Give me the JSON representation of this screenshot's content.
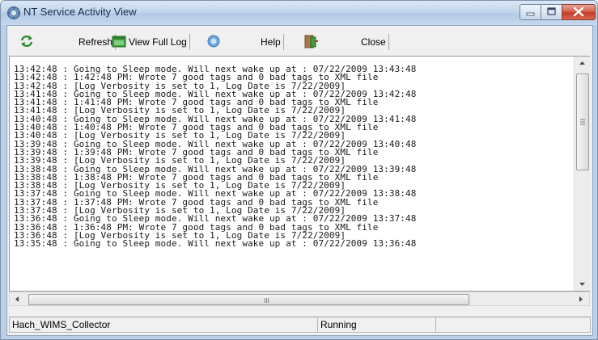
{
  "window": {
    "title": "NT Service Activity View"
  },
  "toolbar": {
    "refresh_label": "Refresh",
    "view_full_log_label": "View Full Log",
    "help_label": "Help",
    "close_label": "Close"
  },
  "log": {
    "lines": [
      "13:42:48 : Going to Sleep mode. Will next wake up at : 07/22/2009 13:43:48",
      "13:42:48 : 1:42:48 PM: Wrote 7 good tags and 0 bad tags to XML file",
      "13:42:48 : [Log Verbosity is set to 1, Log Date is 7/22/2009]",
      "13:41:48 : Going to Sleep mode. Will next wake up at : 07/22/2009 13:42:48",
      "13:41:48 : 1:41:48 PM: Wrote 7 good tags and 0 bad tags to XML file",
      "13:41:48 : [Log Verbosity is set to 1, Log Date is 7/22/2009]",
      "13:40:48 : Going to Sleep mode. Will next wake up at : 07/22/2009 13:41:48",
      "13:40:48 : 1:40:48 PM: Wrote 7 good tags and 0 bad tags to XML file",
      "13:40:48 : [Log Verbosity is set to 1, Log Date is 7/22/2009]",
      "13:39:48 : Going to Sleep mode. Will next wake up at : 07/22/2009 13:40:48",
      "13:39:48 : 1:39:48 PM: Wrote 7 good tags and 0 bad tags to XML file",
      "13:39:48 : [Log Verbosity is set to 1, Log Date is 7/22/2009]",
      "13:38:48 : Going to Sleep mode. Will next wake up at : 07/22/2009 13:39:48",
      "13:38:48 : 1:38:48 PM: Wrote 7 good tags and 0 bad tags to XML file",
      "13:38:48 : [Log Verbosity is set to 1, Log Date is 7/22/2009]",
      "13:37:48 : Going to Sleep mode. Will next wake up at : 07/22/2009 13:38:48",
      "13:37:48 : 1:37:48 PM: Wrote 7 good tags and 0 bad tags to XML file",
      "13:37:48 : [Log Verbosity is set to 1, Log Date is 7/22/2009]",
      "13:36:48 : Going to Sleep mode. Will next wake up at : 07/22/2009 13:37:48",
      "13:36:48 : 1:36:48 PM: Wrote 7 good tags and 0 bad tags to XML file",
      "13:36:48 : [Log Verbosity is set to 1, Log Date is 7/22/2009]",
      "13:35:48 : Going to Sleep mode. Will next wake up at : 07/22/2009 13:36:48"
    ]
  },
  "statusbar": {
    "service_name": "Hach_WIMS_Collector",
    "service_state": "Running"
  },
  "scroll": {
    "horizontal_grip": "III"
  },
  "icons": {
    "app": "service-gear-icon",
    "refresh": "refresh-arrows-icon",
    "view_full_log": "log-window-icon",
    "help": "help-circle-icon",
    "close": "exit-door-icon"
  },
  "colors": {
    "title_bar": "#c3d6ec",
    "close_button": "#c6392a",
    "client_background": "#f0f0f0"
  }
}
